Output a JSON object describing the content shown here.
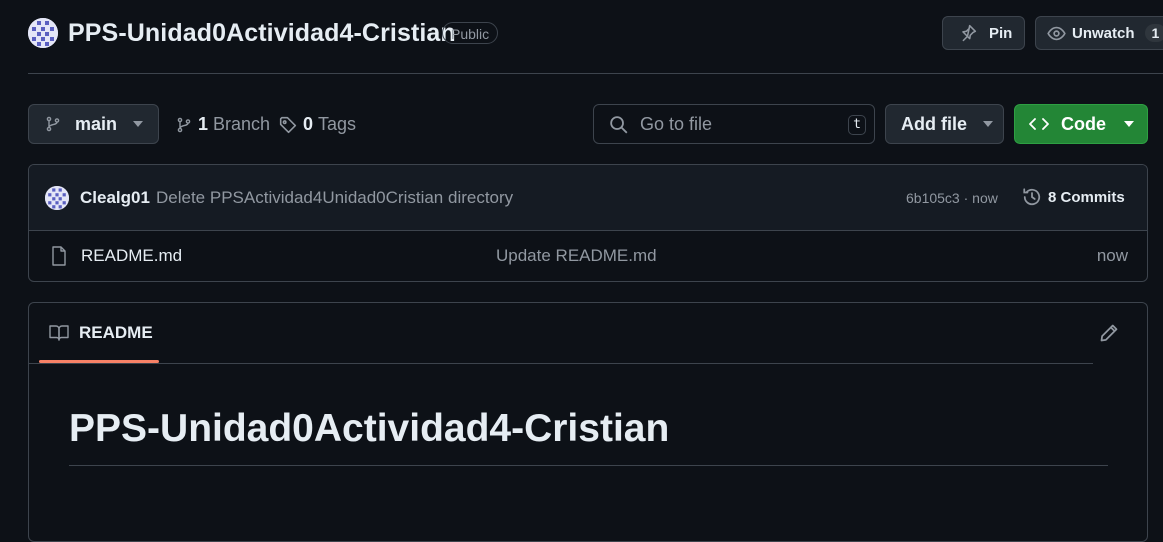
{
  "repo": {
    "name": "PPS-Unidad0Actividad4-Cristian",
    "visibility": "Public"
  },
  "header_actions": {
    "pin_label": "Pin",
    "watch_label": "Unwatch",
    "watch_count": "1"
  },
  "toolbar": {
    "branch": "main",
    "branch_count": "1",
    "branch_label": "Branch",
    "tag_count": "0",
    "tag_label": "Tags",
    "search_placeholder": "Go to file",
    "search_shortcut": "t",
    "add_file_label": "Add file",
    "code_label": "Code"
  },
  "latest_commit": {
    "author": "Clealg01",
    "message": "Delete PPSActividad4Unidad0Cristian directory",
    "hash_time": "6b105c3 · now",
    "commits_count": "8",
    "commits_label": "Commits"
  },
  "files": [
    {
      "name": "README.md",
      "last_commit": "Update README.md",
      "time": "now",
      "icon": "file-icon"
    }
  ],
  "readme": {
    "tab_label": "README",
    "heading": "PPS-Unidad0Actividad4-Cristian"
  },
  "colors": {
    "background": "#0d1117",
    "border": "#3d444d",
    "primary_button": "#238636",
    "tab_underline": "#f78166"
  }
}
